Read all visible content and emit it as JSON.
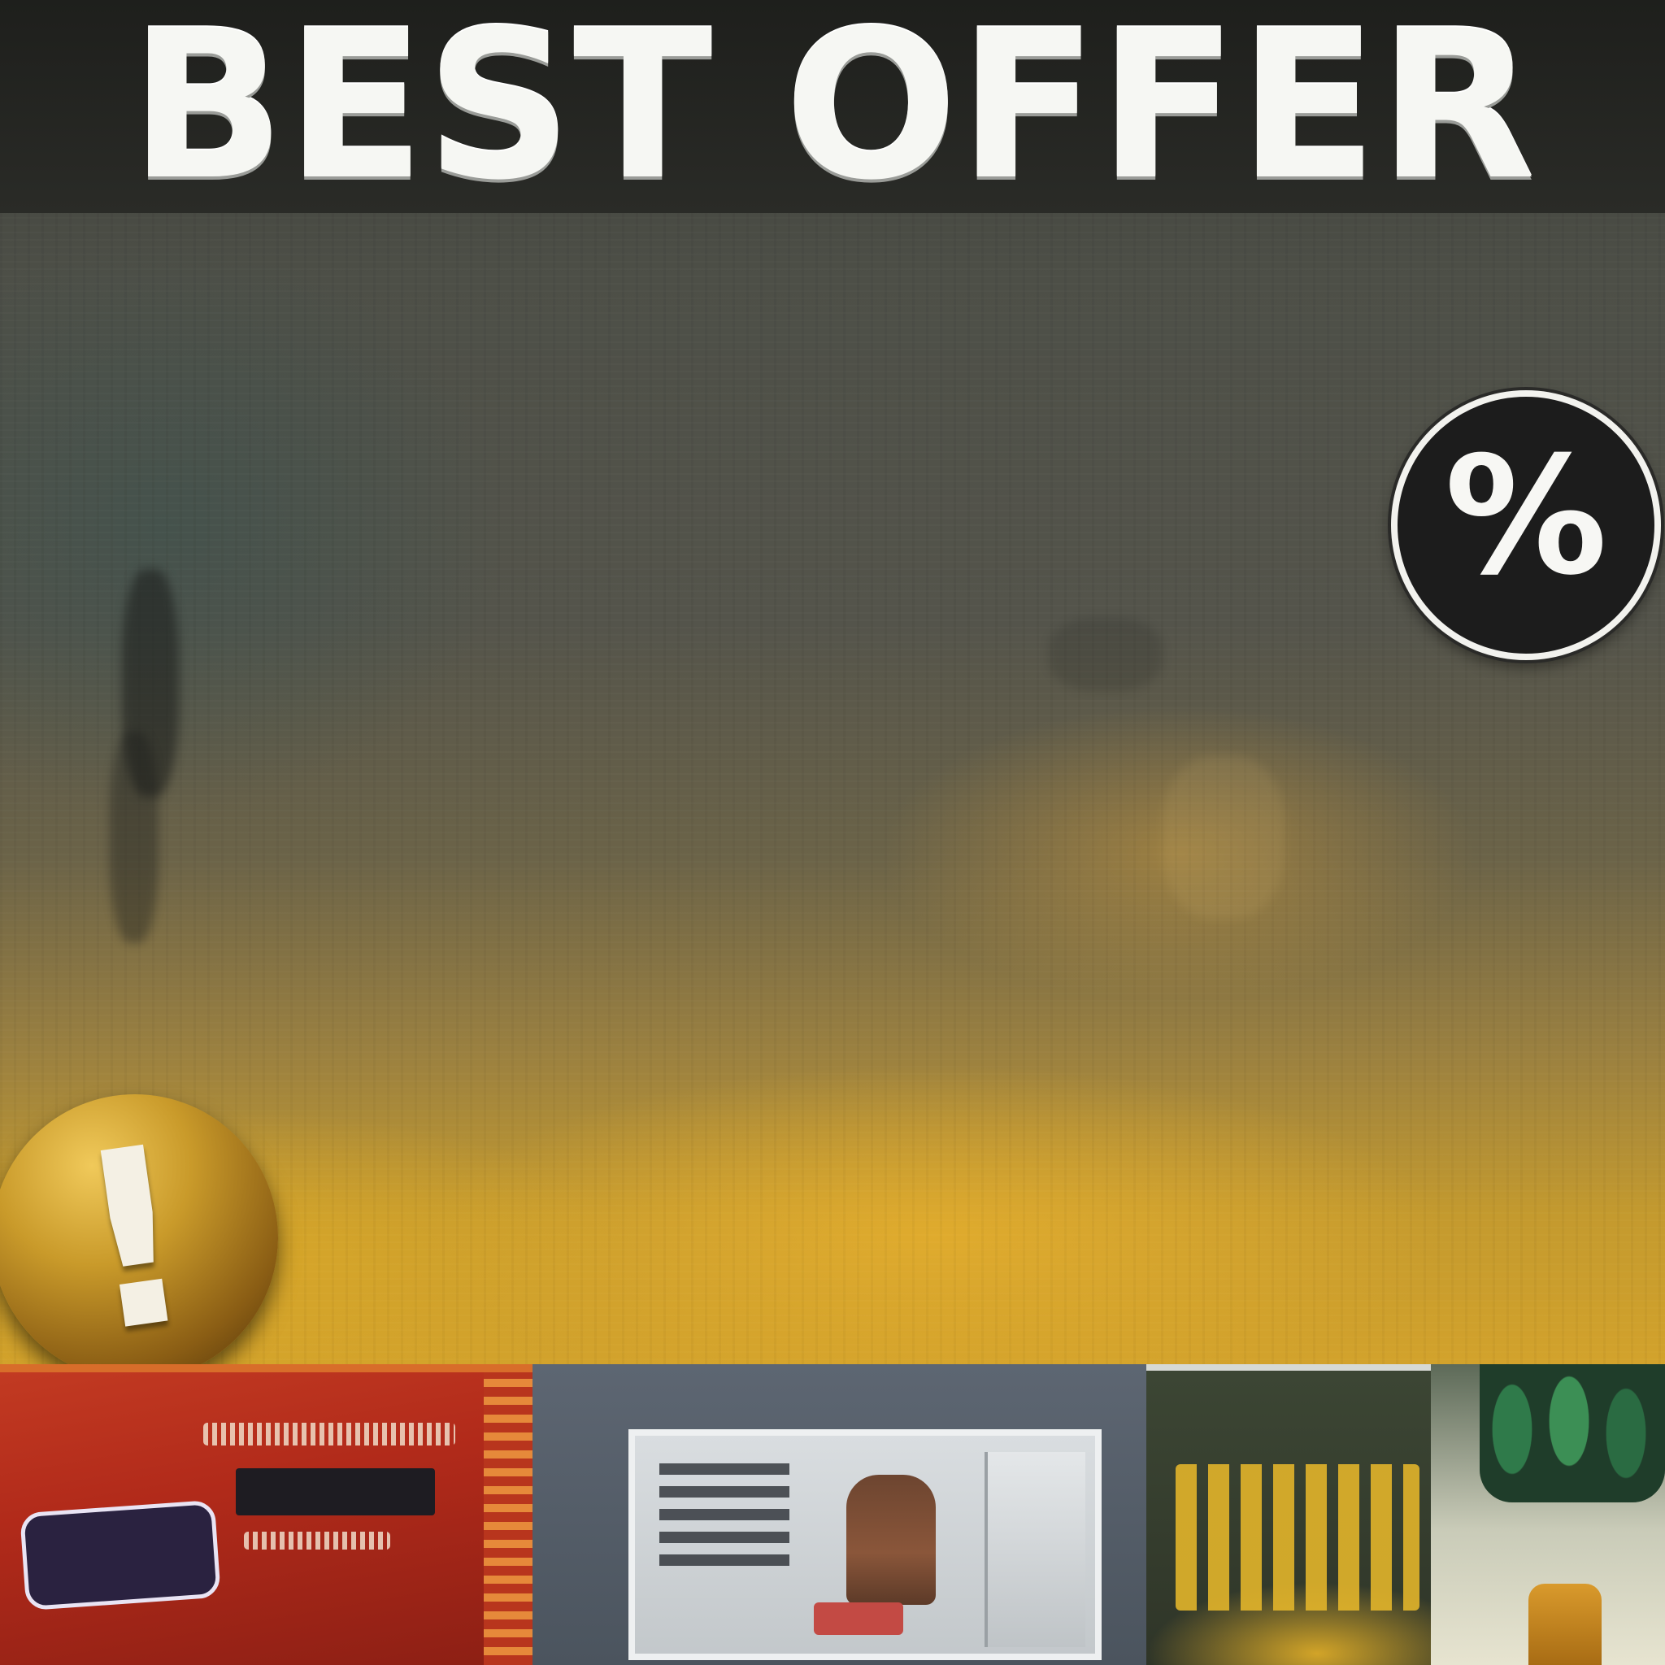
{
  "poster": {
    "title": "BEST OFFER",
    "percent_badge": {
      "glyph": "%",
      "icon": "percent-icon",
      "background_color": "#1c1c1c",
      "glyph_color": "#f7f7f4"
    },
    "alert_badge": {
      "glyph": "!",
      "icon": "exclamation-icon",
      "color": "#c99a2a"
    },
    "colors": {
      "title_band": "#1e1f1c",
      "title_text": "#f6f7f3",
      "accent_gold": "#d4a32b",
      "accent_red": "#b12a1a"
    }
  }
}
